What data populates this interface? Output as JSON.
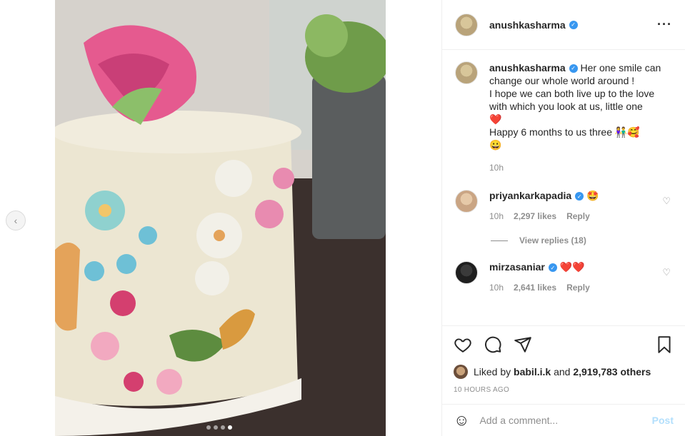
{
  "media": {
    "description_alt": "",
    "carousel_dots": 4,
    "active_dot": 3
  },
  "header": {
    "username": "anushkasharma",
    "more_icon": "more-horizontal-icon"
  },
  "caption": {
    "username": "anushkasharma",
    "text_line1": "Her one smile can change our whole world around !",
    "text_line2": "I hope we can both live up to the love with which you look at us, little one",
    "heart": "❤️",
    "text_line3": "Happy 6 months to us three 👫🥰",
    "smile": "😀",
    "time": "10h"
  },
  "comments": [
    {
      "username": "priyankarkapadia",
      "text": "🤩",
      "time": "10h",
      "likes": "2,297 likes",
      "reply": "Reply",
      "view_replies": "View replies (18)"
    },
    {
      "username": "mirzasaniar",
      "text": "❤️❤️",
      "time": "10h",
      "likes": "2,641 likes",
      "reply": "Reply"
    }
  ],
  "likes": {
    "prefix": "Liked by",
    "user": "babil.i.k",
    "and": "and",
    "others": "2,919,783 others"
  },
  "timestamp": "10 HOURS AGO",
  "add_comment": {
    "placeholder": "Add a comment...",
    "post_label": "Post"
  },
  "colors": {
    "verified": "#3897f0",
    "post_disabled": "#b2dffc",
    "muted": "#8e8e8e"
  }
}
